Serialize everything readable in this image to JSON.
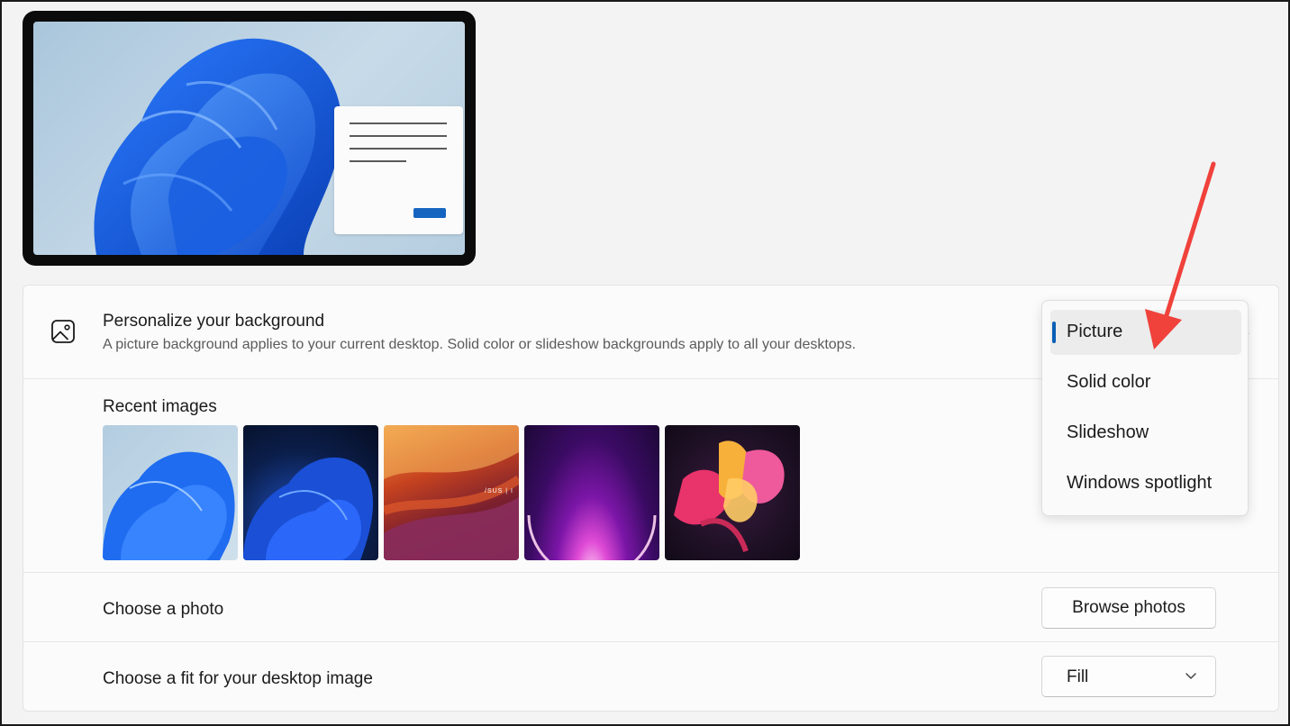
{
  "header": {
    "title": "Personalize your background",
    "description": "A picture background applies to your current desktop. Solid color or slideshow backgrounds apply to all your desktops.",
    "icon": "image-icon"
  },
  "recent": {
    "title": "Recent images",
    "thumbnails": [
      "bloom-light-wallpaper",
      "bloom-dark-wallpaper",
      "asus-canyon-wallpaper",
      "purple-orb-wallpaper",
      "ribbon-flower-wallpaper"
    ],
    "asus_text": "/SUS | I"
  },
  "choose_photo": {
    "label": "Choose a photo",
    "button": "Browse photos"
  },
  "fit": {
    "label": "Choose a fit for your desktop image",
    "selected": "Fill"
  },
  "background_dropdown": {
    "options": [
      "Picture",
      "Solid color",
      "Slideshow",
      "Windows spotlight"
    ],
    "selected": "Picture"
  },
  "colors": {
    "accent": "#0a5fb4",
    "annotation_arrow": "#f0413b"
  }
}
